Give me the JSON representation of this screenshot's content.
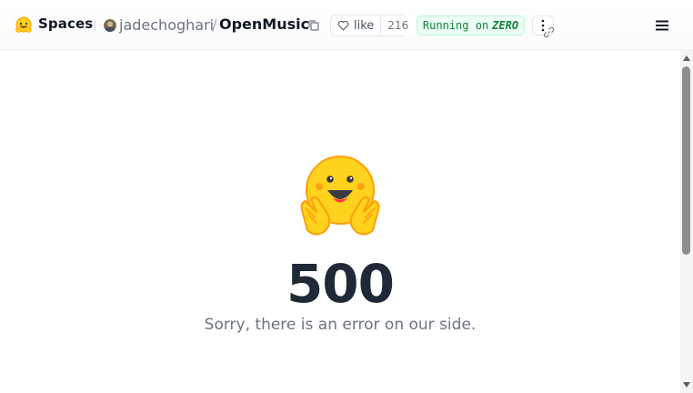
{
  "header": {
    "brand": "Spaces",
    "owner": "jadechoghari",
    "separator": "/",
    "repo": "OpenMusic",
    "like_label": "like",
    "like_count": "216",
    "status_prefix": "Running on",
    "status_hardware": "ZERO"
  },
  "error": {
    "code": "500",
    "message": "Sorry, there is an error on our side."
  },
  "icons": {
    "logo": "hugging-face-icon",
    "copy": "copy-icon",
    "like": "heart-icon",
    "more": "more-vertical-icon",
    "link": "link-icon",
    "menu": "hamburger-menu-icon",
    "hero": "hugging-face-emoji"
  },
  "colors": {
    "status_bg": "#ecfdf5",
    "status_text": "#16803c",
    "emoji_yellow": "#FFD21E",
    "emoji_orange": "#FF9D0B"
  }
}
